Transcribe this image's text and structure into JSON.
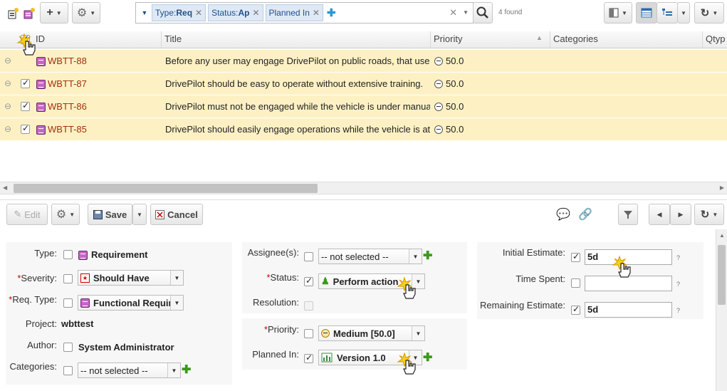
{
  "toolbar": {
    "new_label": "+",
    "found": "4 found",
    "filters": [
      {
        "prefix": "Type: ",
        "value": "Req"
      },
      {
        "prefix": "Status: ",
        "value": "Ap"
      },
      {
        "prefix": "Planned In",
        "value": ""
      }
    ]
  },
  "grid": {
    "columns": [
      "ID",
      "Title",
      "Priority",
      "Categories",
      "Qtyp"
    ],
    "rows": [
      {
        "id": "WBTT-88",
        "title": "Before any user may engage DrivePilot on public roads, that user",
        "priority": "50.0"
      },
      {
        "id": "WBTT-87",
        "title": "DrivePilot should be easy to operate without extensive training.",
        "priority": "50.0"
      },
      {
        "id": "WBTT-86",
        "title": "DrivePilot must not be engaged while the vehicle is under manua",
        "priority": "50.0"
      },
      {
        "id": "WBTT-85",
        "title": "DrivePilot should easily engage operations while the vehicle is at",
        "priority": "50.0"
      }
    ]
  },
  "editor": {
    "edit": "Edit",
    "save": "Save",
    "cancel": "Cancel"
  },
  "form": {
    "type_label": "Type:",
    "type_value": "Requirement",
    "severity_label": "Severity:",
    "severity_value": "Should Have",
    "reqtype_label": "Req. Type:",
    "reqtype_value": "Functional Requir",
    "project_label": "Project:",
    "project_value": "wbttest",
    "author_label": "Author:",
    "author_value": "System Administrator",
    "categories_label": "Categories:",
    "categories_value": "-- not selected --",
    "assignee_label": "Assignee(s):",
    "assignee_value": "-- not selected --",
    "status_label": "Status:",
    "status_value": "Perform action",
    "resolution_label": "Resolution:",
    "priority_label": "Priority:",
    "priority_value": "Medium [50.0]",
    "plannedin_label": "Planned In:",
    "plannedin_value": "Version 1.0",
    "initial_label": "Initial Estimate:",
    "initial_value": "5d",
    "spent_label": "Time Spent:",
    "spent_value": "",
    "remaining_label": "Remaining Estimate:",
    "remaining_value": "5d",
    "help": "?"
  },
  "colors": {
    "row_highlight": "#fdf1c4",
    "id_link": "#a03010",
    "accent": "#3a9a1a"
  }
}
